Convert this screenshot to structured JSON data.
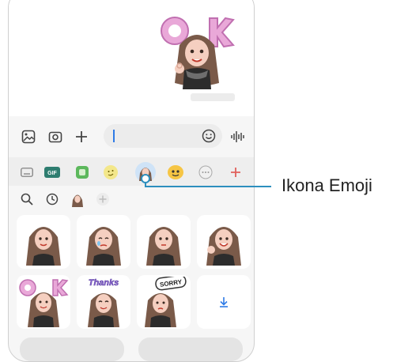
{
  "callout": {
    "label": "Ikona Emoji"
  },
  "colors": {
    "accent": "#2d8fbe",
    "caret": "#2f7be6",
    "add": "#e0605c"
  },
  "stickers": {
    "sent": {
      "text": "OK"
    },
    "grid": [
      {
        "text": ""
      },
      {
        "text": ""
      },
      {
        "text": ""
      },
      {
        "text": ""
      },
      {
        "text": "OK"
      },
      {
        "text": "Thanks"
      },
      {
        "text": "SORRY"
      }
    ]
  },
  "icons": {
    "input_row": [
      "gallery-icon",
      "camera-icon",
      "plus-icon",
      "smiley-icon",
      "voice-icon"
    ],
    "tabs": [
      "keyboard-icon",
      "gif-icon",
      "sticker-icon",
      "emoji-sticker-icon",
      "emoji-avatar-icon",
      "bitmoji-icon",
      "more-stickers-icon",
      "add-icon"
    ],
    "subbar": [
      "search-icon",
      "recent-icon",
      "avatar-icon",
      "add-icon"
    ],
    "download": "download-icon"
  }
}
